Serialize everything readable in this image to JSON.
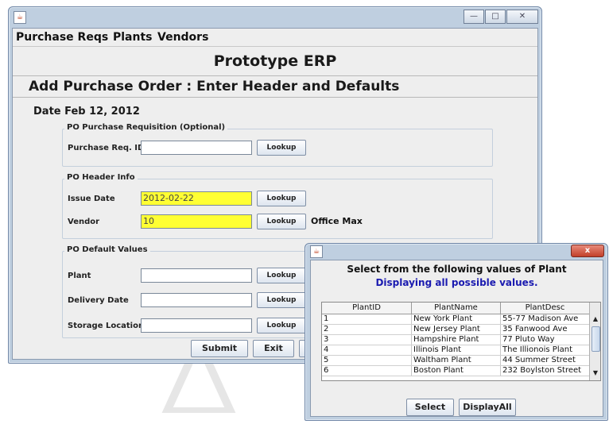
{
  "main_window": {
    "menu": [
      "Purchase Reqs",
      "Plants",
      "Vendors"
    ],
    "app_title": "Prototype ERP",
    "page_title": "Add Purchase Order : Enter Header and Defaults",
    "date_label": "Date Feb 12, 2012",
    "requisition_group": {
      "title": "PO Purchase Requisition (Optional)",
      "purchase_req_label": "Purchase Req. ID",
      "purchase_req_value": "",
      "lookup_label": "Lookup"
    },
    "header_group": {
      "title": "PO Header Info",
      "issue_date_label": "Issue Date",
      "issue_date_value": "2012-02-22",
      "vendor_label": "Vendor",
      "vendor_value": "10",
      "vendor_name": "Office Max",
      "lookup_label": "Lookup"
    },
    "defaults_group": {
      "title": "PO Default Values",
      "plant_label": "Plant",
      "plant_value": "",
      "delivery_date_label": "Delivery Date",
      "delivery_date_value": "",
      "storage_location_label": "Storage Location",
      "storage_location_value": "",
      "lookup_label": "Lookup"
    },
    "buttons": {
      "submit": "Submit",
      "exit": "Exit"
    }
  },
  "lookup_dialog": {
    "close_label": "x",
    "title": "Select from the following values of Plant",
    "subtitle": "Displaying all possible values.",
    "columns": [
      "PlantID",
      "PlantName",
      "PlantDesc"
    ],
    "rows": [
      [
        "1",
        "New York Plant",
        "55-77 Madison Ave"
      ],
      [
        "2",
        "New Jersey Plant",
        "35 Fanwood Ave"
      ],
      [
        "3",
        "Hampshire Plant",
        "77 Pluto Way"
      ],
      [
        "4",
        "Illinois Plant",
        "The Illionois Plant"
      ],
      [
        "5",
        "Waltham Plant",
        "44 Summer Street"
      ],
      [
        "6",
        "Boston Plant",
        "232 Boylston Street"
      ]
    ],
    "select_label": "Select",
    "display_all_label": "DisplayAll"
  },
  "colors": {
    "required_field": "#ffff33",
    "subtitle_blue": "#1a1ab0",
    "window_frame": "#bfcfe0"
  },
  "icons": [
    "java-cup-icon",
    "minimize-icon",
    "maximize-icon",
    "close-icon",
    "scroll-up-icon",
    "scroll-down-icon"
  ]
}
